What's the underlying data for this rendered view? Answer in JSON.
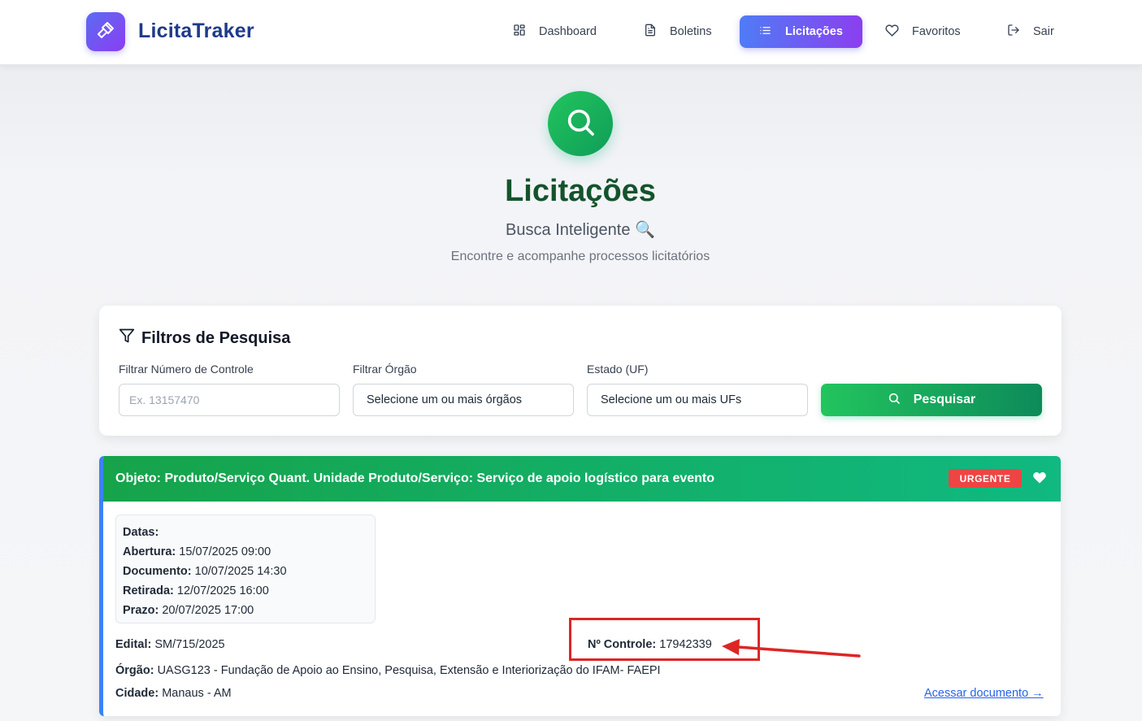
{
  "app": {
    "brand": "LicitaTraker",
    "brand_icon": "gavel-icon"
  },
  "nav": {
    "items": [
      {
        "label": "Dashboard",
        "icon": "grid-icon"
      },
      {
        "label": "Boletins",
        "icon": "document-icon"
      },
      {
        "label": "Licitações",
        "icon": "list-icon",
        "active": true
      },
      {
        "label": "Favoritos",
        "icon": "heart-icon"
      },
      {
        "label": "Sair",
        "icon": "logout-icon"
      }
    ]
  },
  "hero": {
    "icon": "search-icon",
    "title": "Licitações",
    "subtitle": "Busca Inteligente 🔍",
    "description": "Encontre e acompanhe processos licitatórios"
  },
  "filters": {
    "title": "Filtros de Pesquisa",
    "control_label": "Filtrar Número de Controle",
    "control_placeholder": "Ex. 13157470",
    "organ_label": "Filtrar Órgão",
    "organ_value": "Selecione um ou mais órgãos",
    "state_label": "Estado (UF)",
    "state_value": "Selecione um ou mais UFs",
    "search_button": "Pesquisar"
  },
  "result": {
    "title": "Objeto: Produto/Serviço Quant. Unidade Produto/Serviço: Serviço de apoio logístico para evento",
    "badge": "URGENTE",
    "dates_heading": "Datas:",
    "dates": [
      {
        "label": "Abertura:",
        "value": "15/07/2025 09:00"
      },
      {
        "label": "Documento:",
        "value": "10/07/2025 14:30"
      },
      {
        "label": "Retirada:",
        "value": "12/07/2025 16:00"
      },
      {
        "label": "Prazo:",
        "value": "20/07/2025 17:00"
      }
    ],
    "edital_label": "Edital:",
    "edital_value": "SM/715/2025",
    "control_label": "Nº Controle:",
    "control_value": "17942339",
    "organ_label": "Órgão:",
    "organ_value": "UASG123 - Fundação de Apoio ao Ensino, Pesquisa, Extensão e Interiorização do IFAM- FAEPI",
    "city_label": "Cidade:",
    "city_value": "Manaus - AM",
    "doc_link": "Acessar documento →"
  },
  "colors": {
    "accent_green": "#16a34a",
    "nav_active_start": "#4f7cf6",
    "nav_active_end": "#8b3ff0",
    "urgent_red": "#ef4444",
    "annotation_red": "#dc2626",
    "title_dark_green": "#14532d"
  }
}
